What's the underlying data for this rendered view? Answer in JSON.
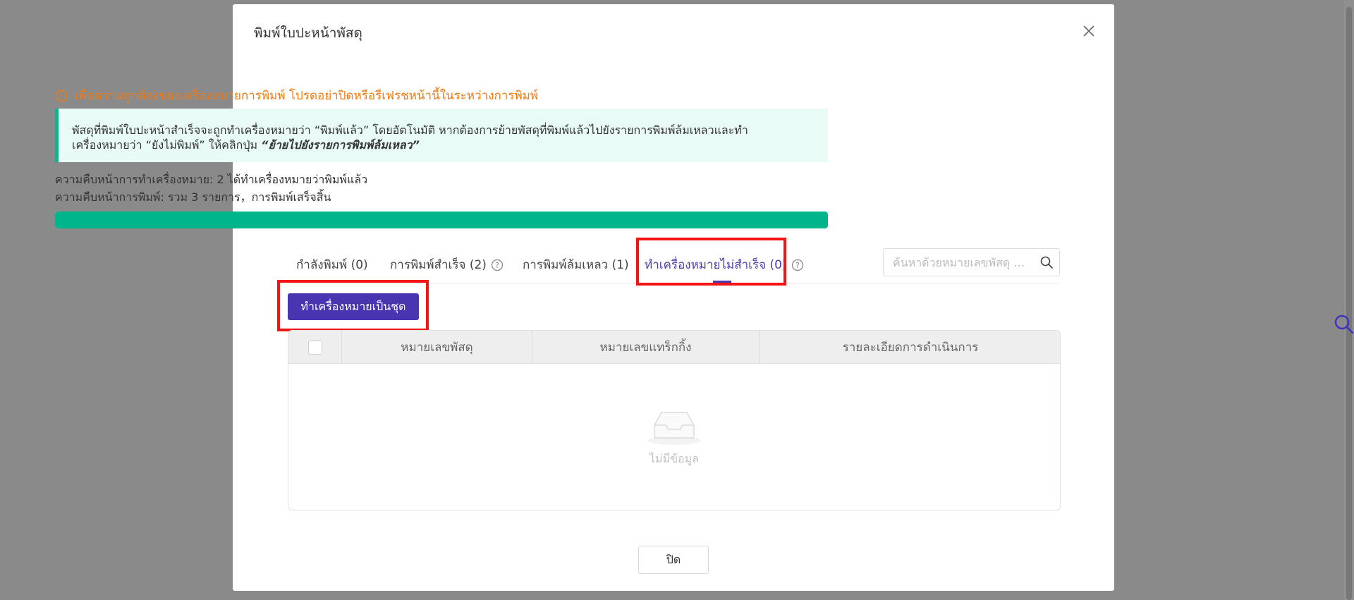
{
  "modal": {
    "title": "พิมพ์ใบปะหน้าพัสดุ",
    "warning": "เพื่อความถูกต้องของเครื่องหมายการพิมพ์ โปรดอย่าปิดหรือรีเฟรชหน้านี้ในระหว่างการพิมพ์",
    "notice_line1": "พัสดุที่พิมพ์ใบปะหน้าสำเร็จจะถูกทำเครื่องหมายว่า “พิมพ์แล้ว” โดยอัตโนมัติ หากต้องการย้ายพัสดุที่พิมพ์แล้วไปยังรายการพิมพ์ล้มเหลวและทำ",
    "notice_line2": "เครื่องหมายว่า “ยังไม่พิมพ์” ให้คลิกปุ่ม",
    "notice_bold": "“ย้ายไปยังรายการพิมพ์ล้มเหลว”",
    "progress_marking": "ความคืบหน้าการทำเครื่องหมาย: 2 ได้ทำเครื่องหมายว่าพิมพ์แล้ว",
    "progress_printing": "ความคืบหน้าการพิมพ์: รวม 3 รายการ，การพิมพ์เสร็จสิ้น",
    "progress_fraction": 1.0,
    "close_label": "ปิด"
  },
  "tabs": [
    {
      "label": "กำลังพิมพ์ (0)"
    },
    {
      "label": "การพิมพ์สำเร็จ (2)"
    },
    {
      "label": "การพิมพ์ล้มเหลว (1)"
    },
    {
      "label": "ทำเครื่องหมายไม่สำเร็จ (0)"
    }
  ],
  "search": {
    "placeholder": "ค้นหาด้วยหมายเลขพัสดุ ..."
  },
  "batch_button": "ทำเครื่องหมายเป็นชุด",
  "table": {
    "columns": [
      "หมายเลขพัสดุ",
      "หมายเลขแทร็กกิ้ง",
      "รายละเอียดการดำเนินการ"
    ],
    "empty_text": "ไม่มีข้อมูล"
  },
  "colors": {
    "accent": "#4a35b0",
    "progress": "#00b48c",
    "warning": "#ee7a14",
    "highlight": "#f51414"
  }
}
